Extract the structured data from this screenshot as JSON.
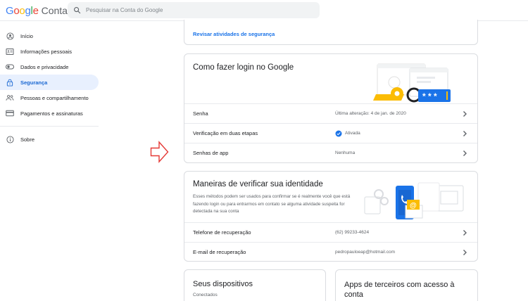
{
  "header": {
    "logo_google": "Google",
    "logo_product": "Conta",
    "search_placeholder": "Pesquisar na Conta do Google"
  },
  "sidebar": {
    "items": [
      {
        "label": "Início",
        "icon": "person-circle-icon"
      },
      {
        "label": "Informações pessoais",
        "icon": "id-card-icon"
      },
      {
        "label": "Dados e privacidade",
        "icon": "toggle-icon"
      },
      {
        "label": "Segurança",
        "icon": "lock-icon",
        "active": true
      },
      {
        "label": "Pessoas e compartilhamento",
        "icon": "people-icon"
      },
      {
        "label": "Pagamentos e assinaturas",
        "icon": "credit-card-icon"
      }
    ],
    "about": {
      "label": "Sobre",
      "icon": "info-icon"
    }
  },
  "security_activity": {
    "link": "Revisar atividades de segurança"
  },
  "login_card": {
    "title": "Como fazer login no Google",
    "rows": [
      {
        "label": "Senha",
        "value": "Última alteração: 4 de jan. de 2020"
      },
      {
        "label": "Verificação em duas etapas",
        "value": "Ativada",
        "status_icon": "check-circle-icon"
      },
      {
        "label": "Senhas de app",
        "value": "Nenhuma"
      }
    ]
  },
  "verify_card": {
    "title": "Maneiras de verificar sua identidade",
    "description": "Esses métodos podem ser usados para confirmar se é realmente você que está fazendo login ou para entrarmos em contato se alguma atividade suspeita for detectada na sua conta",
    "rows": [
      {
        "label": "Telefone de recuperação",
        "value": "(62) 99233-4624"
      },
      {
        "label": "E-mail de recuperação",
        "value": "pedropauloeap@hotmail.com"
      }
    ]
  },
  "devices_card": {
    "title": "Seus dispositivos",
    "subtitle": "Conectados"
  },
  "apps_card": {
    "title": "Apps de terceiros com acesso à conta"
  },
  "colors": {
    "accent": "#1a73e8",
    "active_bg": "#e8f0fe",
    "arrow": "#e53935",
    "check": "#1a73e8"
  }
}
